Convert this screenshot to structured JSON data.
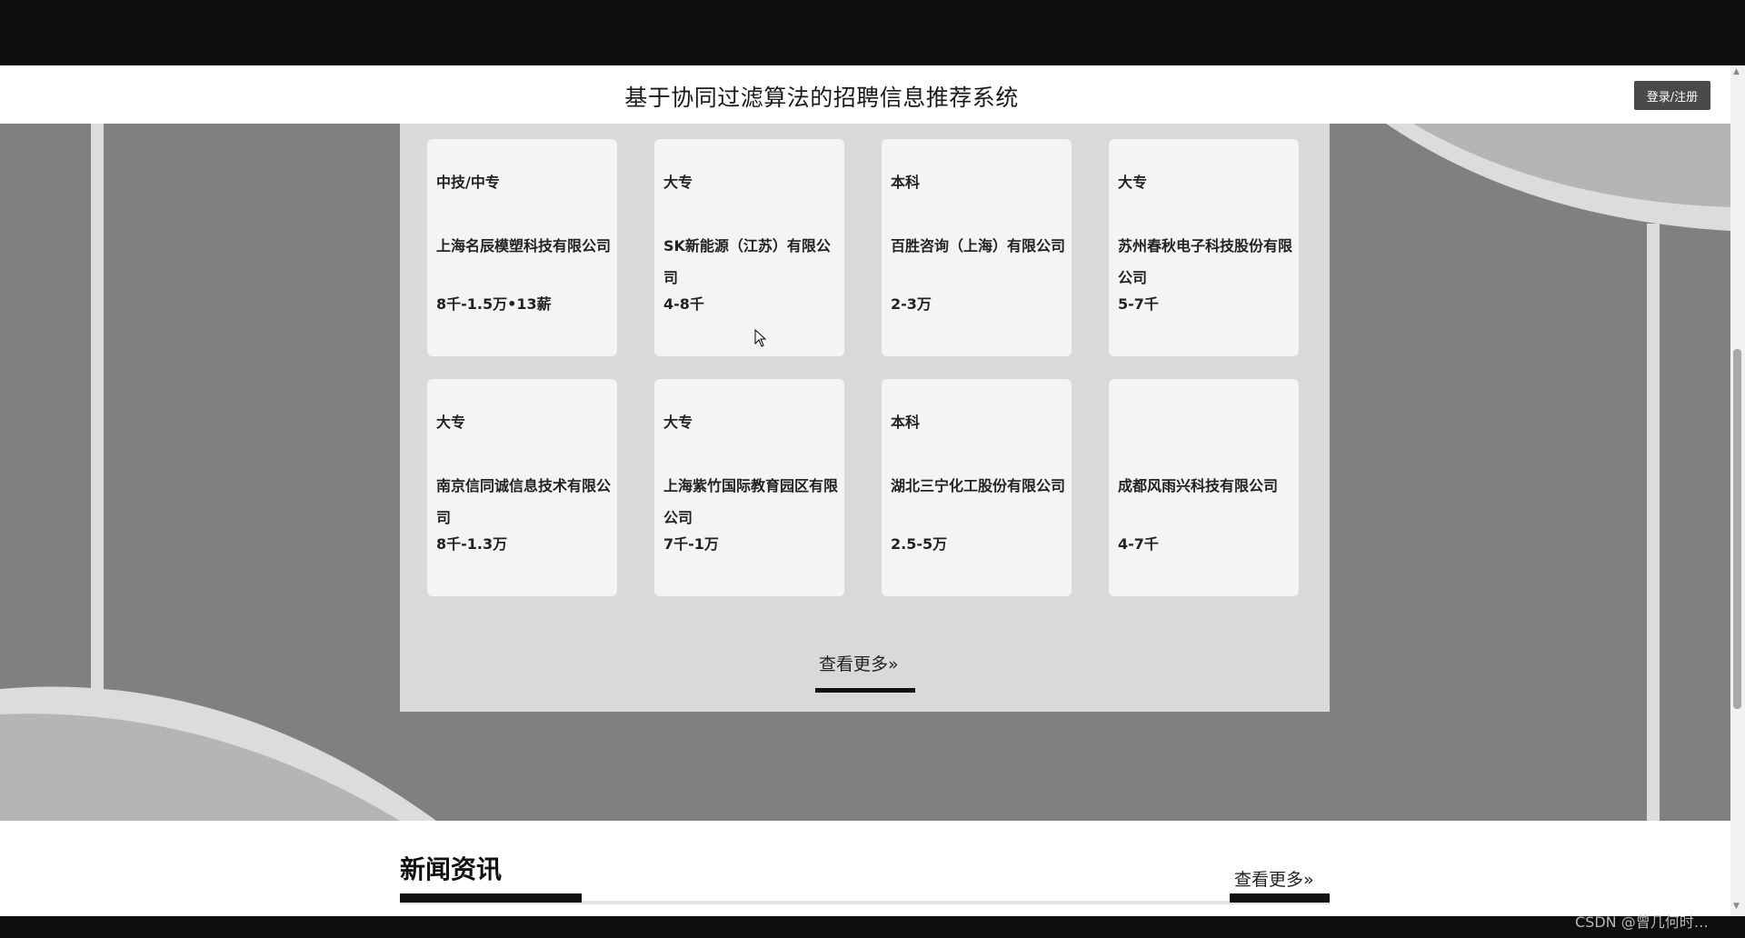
{
  "header": {
    "title": "基于协同过滤算法的招聘信息推荐系统",
    "login_label": "登录/注册"
  },
  "jobs": [
    {
      "education": "中技/中专",
      "company": "上海名辰模塑科技有限公司",
      "salary": "8千-1.5万•13薪"
    },
    {
      "education": "大专",
      "company": "SK新能源（江苏）有限公司",
      "salary": "4-8千"
    },
    {
      "education": "本科",
      "company": "百胜咨询（上海）有限公司",
      "salary": "2-3万"
    },
    {
      "education": "大专",
      "company": "苏州春秋电子科技股份有限公司",
      "salary": "5-7千"
    },
    {
      "education": "大专",
      "company": "南京信同诚信息技术有限公司",
      "salary": "8千-1.3万"
    },
    {
      "education": "大专",
      "company": "上海紫竹国际教育园区有限公司",
      "salary": "7千-1万"
    },
    {
      "education": "本科",
      "company": "湖北三宁化工股份有限公司",
      "salary": "2.5-5万"
    },
    {
      "education": "",
      "company": "成都风雨兴科技有限公司",
      "salary": "4-7千"
    }
  ],
  "jobs_more_label": "查看更多»",
  "news": {
    "title": "新闻资讯",
    "more_label": "查看更多»"
  },
  "watermark": "CSDN @曾几何时…",
  "colors": {
    "background_gray": "#808080",
    "panel": "#d9d9d9",
    "card": "#f4f4f5",
    "login_button": "#4a4a4a"
  }
}
